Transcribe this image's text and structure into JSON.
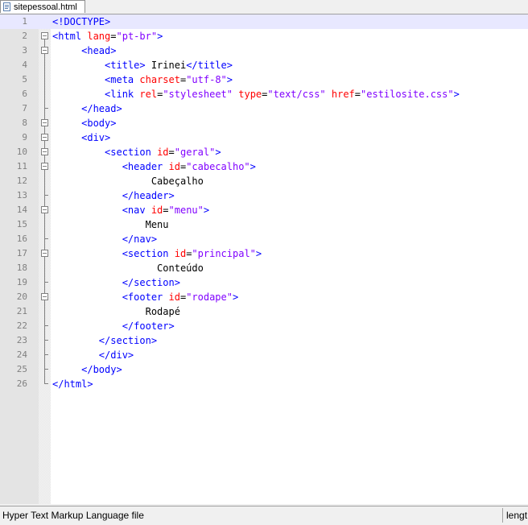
{
  "tab": {
    "filename": "sitepessoal.html",
    "icon": "html-file-icon"
  },
  "status": {
    "file_type": "Hyper Text Markup Language file",
    "length_label": "lengt"
  },
  "current_line": 1,
  "lines": [
    {
      "n": "1",
      "indent": 0,
      "fold": "none",
      "tokens": [
        [
          "t",
          "<!DOCTYPE>"
        ]
      ]
    },
    {
      "n": "2",
      "indent": 0,
      "fold": "box",
      "tokens": [
        [
          "t",
          "<html "
        ],
        [
          "a",
          "lang"
        ],
        [
          "x",
          "="
        ],
        [
          "v",
          "\"pt-br\""
        ],
        [
          "t",
          ">"
        ]
      ]
    },
    {
      "n": "3",
      "indent": 5,
      "fold": "box",
      "tokens": [
        [
          "t",
          "<head>"
        ]
      ]
    },
    {
      "n": "4",
      "indent": 9,
      "fold": "line",
      "tokens": [
        [
          "t",
          "<title>"
        ],
        [
          "x",
          " Irinei"
        ],
        [
          "t",
          "</title>"
        ]
      ]
    },
    {
      "n": "5",
      "indent": 9,
      "fold": "line",
      "tokens": [
        [
          "t",
          "<meta "
        ],
        [
          "a",
          "charset"
        ],
        [
          "x",
          "="
        ],
        [
          "v",
          "\"utf-8\""
        ],
        [
          "t",
          ">"
        ]
      ]
    },
    {
      "n": "6",
      "indent": 9,
      "fold": "line",
      "tokens": [
        [
          "t",
          "<link "
        ],
        [
          "a",
          "rel"
        ],
        [
          "x",
          "="
        ],
        [
          "v",
          "\"stylesheet\""
        ],
        [
          "x",
          " "
        ],
        [
          "a",
          "type"
        ],
        [
          "x",
          "="
        ],
        [
          "v",
          "\"text/css\""
        ],
        [
          "x",
          " "
        ],
        [
          "a",
          "href"
        ],
        [
          "x",
          "="
        ],
        [
          "v",
          "\"estilosite.css\""
        ],
        [
          "t",
          ">"
        ]
      ]
    },
    {
      "n": "7",
      "indent": 5,
      "fold": "end",
      "tokens": [
        [
          "t",
          "</head>"
        ]
      ]
    },
    {
      "n": "8",
      "indent": 5,
      "fold": "box",
      "tokens": [
        [
          "t",
          "<body>"
        ]
      ]
    },
    {
      "n": "9",
      "indent": 5,
      "fold": "box",
      "tokens": [
        [
          "t",
          "<div>"
        ]
      ]
    },
    {
      "n": "10",
      "indent": 9,
      "fold": "box",
      "tokens": [
        [
          "t",
          "<section "
        ],
        [
          "a",
          "id"
        ],
        [
          "x",
          "="
        ],
        [
          "v",
          "\"geral\""
        ],
        [
          "t",
          ">"
        ]
      ]
    },
    {
      "n": "11",
      "indent": 12,
      "fold": "box",
      "tokens": [
        [
          "t",
          "<header "
        ],
        [
          "a",
          "id"
        ],
        [
          "x",
          "="
        ],
        [
          "v",
          "\"cabecalho\""
        ],
        [
          "t",
          ">"
        ]
      ]
    },
    {
      "n": "12",
      "indent": 17,
      "fold": "line",
      "tokens": [
        [
          "x",
          "Cabeçalho"
        ]
      ]
    },
    {
      "n": "13",
      "indent": 12,
      "fold": "end",
      "tokens": [
        [
          "t",
          "</header>"
        ]
      ]
    },
    {
      "n": "14",
      "indent": 12,
      "fold": "box",
      "tokens": [
        [
          "t",
          "<nav "
        ],
        [
          "a",
          "id"
        ],
        [
          "x",
          "="
        ],
        [
          "v",
          "\"menu\""
        ],
        [
          "t",
          ">"
        ]
      ]
    },
    {
      "n": "15",
      "indent": 16,
      "fold": "line",
      "tokens": [
        [
          "x",
          "Menu"
        ]
      ]
    },
    {
      "n": "16",
      "indent": 12,
      "fold": "end",
      "tokens": [
        [
          "t",
          "</nav>"
        ]
      ]
    },
    {
      "n": "17",
      "indent": 12,
      "fold": "box",
      "tokens": [
        [
          "t",
          "<section "
        ],
        [
          "a",
          "id"
        ],
        [
          "x",
          "="
        ],
        [
          "v",
          "\"principal\""
        ],
        [
          "t",
          ">"
        ]
      ]
    },
    {
      "n": "18",
      "indent": 18,
      "fold": "line",
      "tokens": [
        [
          "x",
          "Conteúdo"
        ]
      ]
    },
    {
      "n": "19",
      "indent": 12,
      "fold": "end",
      "tokens": [
        [
          "t",
          "</section>"
        ]
      ]
    },
    {
      "n": "20",
      "indent": 12,
      "fold": "box",
      "tokens": [
        [
          "t",
          "<footer "
        ],
        [
          "a",
          "id"
        ],
        [
          "x",
          "="
        ],
        [
          "v",
          "\"rodape\""
        ],
        [
          "t",
          ">"
        ]
      ]
    },
    {
      "n": "21",
      "indent": 16,
      "fold": "line",
      "tokens": [
        [
          "x",
          "Rodapé"
        ]
      ]
    },
    {
      "n": "22",
      "indent": 12,
      "fold": "end",
      "tokens": [
        [
          "t",
          "</footer>"
        ]
      ]
    },
    {
      "n": "23",
      "indent": 8,
      "fold": "end",
      "tokens": [
        [
          "t",
          "</section>"
        ]
      ]
    },
    {
      "n": "24",
      "indent": 8,
      "fold": "end",
      "tokens": [
        [
          "t",
          "</div>"
        ]
      ]
    },
    {
      "n": "25",
      "indent": 5,
      "fold": "end",
      "tokens": [
        [
          "t",
          "</body>"
        ]
      ]
    },
    {
      "n": "26",
      "indent": 0,
      "fold": "end",
      "tokens": [
        [
          "t",
          "</html>"
        ]
      ]
    }
  ]
}
